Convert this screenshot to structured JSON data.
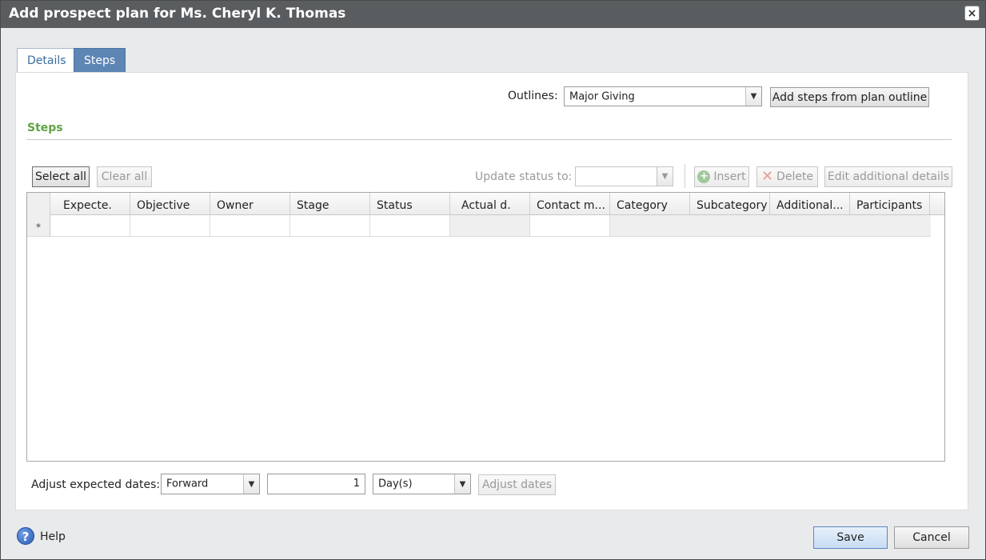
{
  "window": {
    "title": "Add prospect plan for Ms. Cheryl K. Thomas",
    "close_glyph": "×"
  },
  "tabs": [
    {
      "label": "Details"
    },
    {
      "label": "Steps"
    }
  ],
  "outlines": {
    "label": "Outlines:",
    "selected": "Major Giving",
    "add_button": "Add steps from plan outline"
  },
  "steps_section": {
    "title": "Steps"
  },
  "toolbar": {
    "select_all": "Select all",
    "clear_all": "Clear all",
    "update_status_label": "Update status to:",
    "update_status_value": "",
    "insert": "Insert",
    "delete": "Delete",
    "edit_details": "Edit additional details"
  },
  "grid": {
    "columns": [
      "Expecte.",
      "Objective",
      "Owner",
      "Stage",
      "Status",
      "Actual d.",
      "Contact m...",
      "Category",
      "Subcategory",
      "Additional...",
      "Participants"
    ],
    "new_row_marker": "*"
  },
  "adjust": {
    "label": "Adjust expected dates:",
    "direction": "Forward",
    "amount": "1",
    "unit": "Day(s)",
    "button": "Adjust dates"
  },
  "footer": {
    "help": "Help",
    "save": "Save",
    "cancel": "Cancel"
  },
  "colors": {
    "title_bar": "#5a5d60",
    "active_tab": "#5e86b5",
    "section_title": "#5fa344"
  },
  "icons": {
    "close": "close-icon",
    "dropdown": "chevron-down-icon",
    "insert": "plus-circle-icon",
    "delete": "x-icon",
    "help": "question-circle-icon"
  }
}
